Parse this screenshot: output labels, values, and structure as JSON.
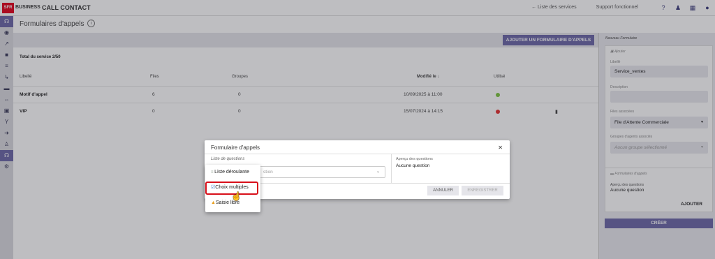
{
  "brand": {
    "logo_text": "SFR",
    "business": "BUSINESS",
    "product": "CALL CONTACT"
  },
  "topnav": {
    "services_link": "← Liste des services",
    "support_link": "Support fonctionnel"
  },
  "page": {
    "title": "Formulaires d'appels"
  },
  "toolbar": {
    "add_form_label": "AJOUTER UN FORMULAIRE D'APPELS"
  },
  "total": "Total du service 2/50",
  "table": {
    "headers": [
      "Libellé",
      "Files",
      "Groupes",
      "Modifié le",
      "Utilisé"
    ],
    "rows": [
      {
        "name": "Motif d'appel",
        "files": "6",
        "groupes": "0",
        "modified": "10/09/2025 à 11:00",
        "status_color": "#7cc43e"
      },
      {
        "name": "VIP",
        "files": "0",
        "groupes": "0",
        "modified": "15/07/2024 à 14:15",
        "status_color": "#e53030"
      }
    ]
  },
  "right_panel": {
    "title": "Nouveau Formulaire",
    "section1_title": "Ajouter",
    "libelle_label": "Libellé",
    "libelle_value": "Service_ventes",
    "description_label": "Description",
    "files_label": "Files associées",
    "files_value": "File d'Attente Commerciale",
    "groupes_label": "Groupes d'agents associés",
    "groupes_placeholder": "Aucun groupe sélectionné",
    "section2_title": "Formulaires d'appels",
    "apercu_label": "Aperçu des questions",
    "apercu_value": "Aucune question",
    "add_label": "AJOUTER",
    "create_label": "CRÉER"
  },
  "modal": {
    "title": "Formulaire d'appels",
    "list_label": "Liste de questions",
    "select_placeholder": "stion",
    "preview_label": "Aperçu des questions",
    "preview_value": "Aucune question",
    "cancel_label": "ANNULER",
    "save_label": "ENREGISTRER"
  },
  "dropdown": {
    "options": [
      "Liste déroulante",
      "Choix multiples",
      "Saisie libre"
    ],
    "highlighted": "Choix multiples"
  },
  "colors": {
    "accent": "#6a66a6",
    "highlight": "#d80f1a"
  }
}
